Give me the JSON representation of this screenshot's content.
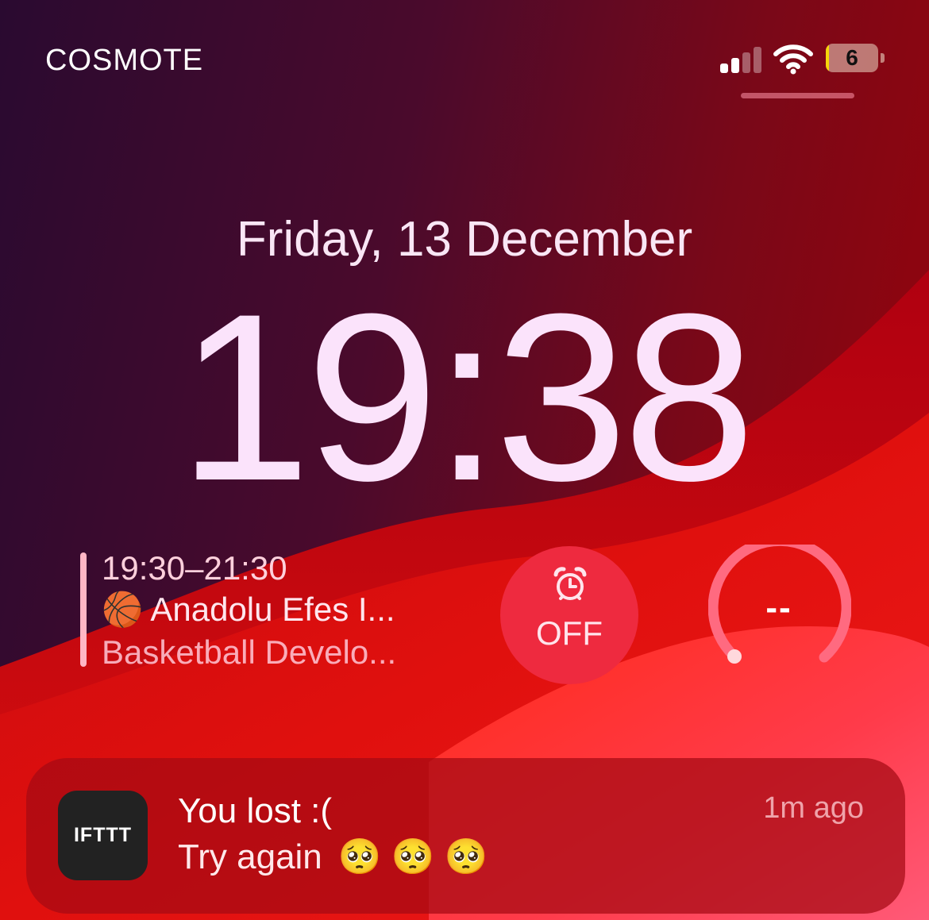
{
  "status_bar": {
    "carrier": "COSMOTE",
    "signal_bars_active": 2,
    "signal_bars_total": 4,
    "battery_level": "6",
    "battery_fraction": 0.06,
    "battery_fill_color": "#f6d60a"
  },
  "lock_screen": {
    "date": "Friday, 13 December",
    "time": "19:38"
  },
  "widgets": {
    "calendar": {
      "time_range": "19:30–21:30",
      "icon": "🏀",
      "title": "Anadolu Efes I...",
      "subtitle": "Basketball Develo..."
    },
    "alarm": {
      "icon": "alarm-clock-icon",
      "status": "OFF"
    },
    "gauge": {
      "value": "--"
    }
  },
  "notification": {
    "app_name": "IFTTT",
    "title": "You lost :(",
    "body": "Try again",
    "emoji": "🥺 🥺 🥺",
    "timestamp": "1m ago"
  },
  "colors": {
    "wallpaper_dark": "#2a0a2e",
    "wallpaper_red": "#e01212",
    "wallpaper_pink": "#ff4d6a",
    "alarm_circle": "#ee2a3f"
  }
}
